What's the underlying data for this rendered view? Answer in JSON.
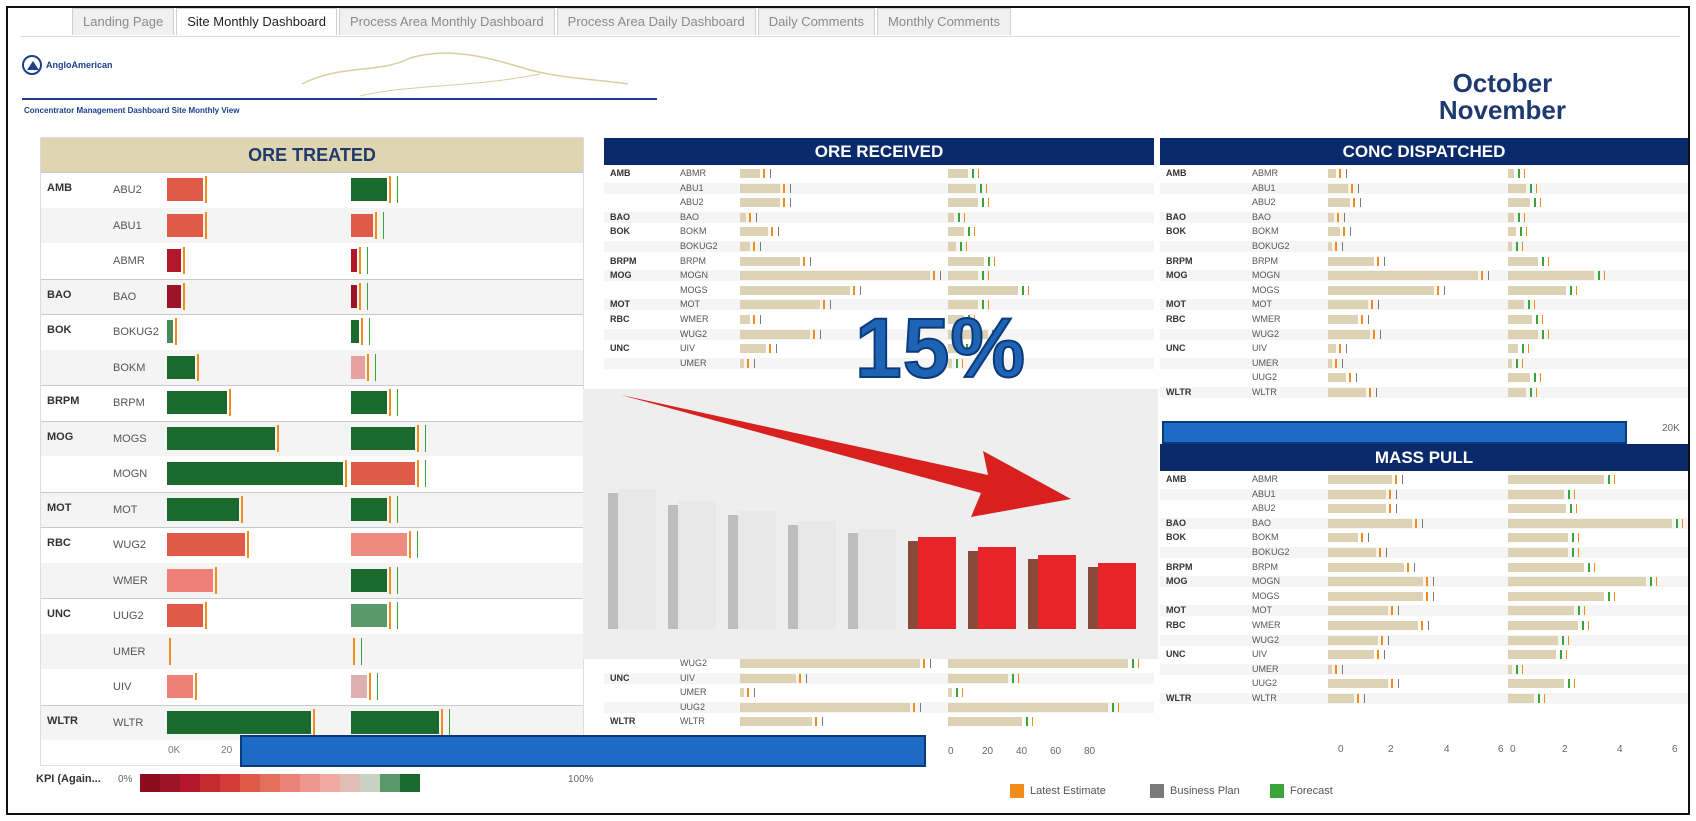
{
  "tabs": [
    "Landing Page",
    "Site Monthly Dashboard",
    "Process Area Monthly Dashboard",
    "Process Area Daily Dashboard",
    "Daily Comments",
    "Monthly Comments"
  ],
  "active_tab": 1,
  "brand": "AngloAmerican",
  "subtitle": "Concentrator Management Dashboard Site Monthly View",
  "months": [
    "October",
    "November"
  ],
  "colors": {
    "navy": "#0b2a6b",
    "khaki": "#dfd5b0",
    "dark_green": "#1b6a2d",
    "red": "#e05a48",
    "orange": "#f08c1a",
    "grey": "#7a7a7a",
    "green": "#3aa33a"
  },
  "ore_treated": {
    "title": "ORE TREATED",
    "rows": [
      {
        "site": "AMB",
        "area": "ABU2"
      },
      {
        "site": "",
        "area": "ABU1"
      },
      {
        "site": "",
        "area": "ABMR"
      },
      {
        "site": "BAO",
        "area": "BAO"
      },
      {
        "site": "BOK",
        "area": "BOKUG2"
      },
      {
        "site": "",
        "area": "BOKM"
      },
      {
        "site": "BRPM",
        "area": "BRPM"
      },
      {
        "site": "MOG",
        "area": "MOGS"
      },
      {
        "site": "",
        "area": "MOGN"
      },
      {
        "site": "MOT",
        "area": "MOT"
      },
      {
        "site": "RBC",
        "area": "WUG2"
      },
      {
        "site": "",
        "area": "WMER"
      },
      {
        "site": "UNC",
        "area": "UUG2"
      },
      {
        "site": "",
        "area": "UMER"
      },
      {
        "site": "",
        "area": "UIV"
      },
      {
        "site": "WLTR",
        "area": "WLTR"
      }
    ],
    "axis_labels": [
      "0K",
      "20"
    ]
  },
  "ore_received": {
    "title": "ORE RECEIVED",
    "rows": [
      {
        "site": "AMB",
        "area": "ABMR"
      },
      {
        "site": "",
        "area": "ABU1"
      },
      {
        "site": "",
        "area": "ABU2"
      },
      {
        "site": "BAO",
        "area": "BAO"
      },
      {
        "site": "BOK",
        "area": "BOKM"
      },
      {
        "site": "",
        "area": "BOKUG2"
      },
      {
        "site": "BRPM",
        "area": "BRPM"
      },
      {
        "site": "MOG",
        "area": "MOGN"
      },
      {
        "site": "",
        "area": "MOGS"
      },
      {
        "site": "MOT",
        "area": "MOT"
      },
      {
        "site": "RBC",
        "area": "WMER"
      },
      {
        "site": "",
        "area": "WUG2"
      },
      {
        "site": "UNC",
        "area": "UIV"
      },
      {
        "site": "",
        "area": "UMER"
      }
    ],
    "rows_bottom": [
      {
        "site": "",
        "area": "WUG2"
      },
      {
        "site": "UNC",
        "area": "UIV"
      },
      {
        "site": "",
        "area": "UMER"
      },
      {
        "site": "",
        "area": "UUG2"
      },
      {
        "site": "WLTR",
        "area": "WLTR"
      }
    ],
    "axis_labels": [
      "0",
      "20",
      "40",
      "60",
      "80"
    ]
  },
  "conc_dispatched": {
    "title": "CONC DISPATCHED",
    "rows": [
      {
        "site": "AMB",
        "area": "ABMR"
      },
      {
        "site": "",
        "area": "ABU1"
      },
      {
        "site": "",
        "area": "ABU2"
      },
      {
        "site": "BAO",
        "area": "BAO"
      },
      {
        "site": "BOK",
        "area": "BOKM"
      },
      {
        "site": "",
        "area": "BOKUG2"
      },
      {
        "site": "BRPM",
        "area": "BRPM"
      },
      {
        "site": "MOG",
        "area": "MOGN"
      },
      {
        "site": "",
        "area": "MOGS"
      },
      {
        "site": "MOT",
        "area": "MOT"
      },
      {
        "site": "RBC",
        "area": "WMER"
      },
      {
        "site": "",
        "area": "WUG2"
      },
      {
        "site": "UNC",
        "area": "UIV"
      },
      {
        "site": "",
        "area": "UMER"
      },
      {
        "site": "",
        "area": "UUG2"
      },
      {
        "site": "WLTR",
        "area": "WLTR"
      }
    ],
    "axis_label": "20K"
  },
  "mass_pull": {
    "title": "MASS PULL",
    "rows": [
      {
        "site": "AMB",
        "area": "ABMR"
      },
      {
        "site": "",
        "area": "ABU1"
      },
      {
        "site": "",
        "area": "ABU2"
      },
      {
        "site": "BAO",
        "area": "BAO"
      },
      {
        "site": "BOK",
        "area": "BOKM"
      },
      {
        "site": "",
        "area": "BOKUG2"
      },
      {
        "site": "BRPM",
        "area": "BRPM"
      },
      {
        "site": "MOG",
        "area": "MOGN"
      },
      {
        "site": "",
        "area": "MOGS"
      },
      {
        "site": "MOT",
        "area": "MOT"
      },
      {
        "site": "RBC",
        "area": "WMER"
      },
      {
        "site": "",
        "area": "WUG2"
      },
      {
        "site": "UNC",
        "area": "UIV"
      },
      {
        "site": "",
        "area": "UMER"
      },
      {
        "site": "",
        "area": "UUG2"
      },
      {
        "site": "WLTR",
        "area": "WLTR"
      }
    ],
    "axis_labels_left": [
      "0",
      "2",
      "4",
      "6"
    ],
    "axis_labels_right": [
      "0",
      "2",
      "4",
      "6"
    ]
  },
  "overlay": {
    "percent": "15%"
  },
  "kpi": {
    "label": "KPI (Again...",
    "min": "0%",
    "max": "100%"
  },
  "legend": [
    {
      "label": "Latest Estimate",
      "color": "#f08c1a"
    },
    {
      "label": "Business Plan",
      "color": "#7a7a7a"
    },
    {
      "label": "Forecast",
      "color": "#3aa33a"
    }
  ]
}
